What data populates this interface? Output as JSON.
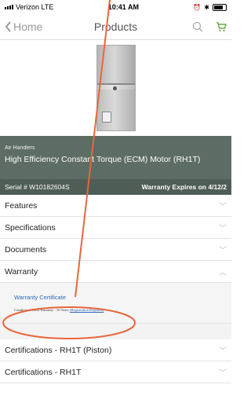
{
  "status_bar": {
    "carrier": "Verizon",
    "network": "LTE",
    "time": "10:41 AM"
  },
  "nav": {
    "back_label": "Home",
    "title": "Products",
    "icons": [
      "back-chevron-icon",
      "search-icon",
      "cart-icon"
    ]
  },
  "product": {
    "category": "Air Handlers",
    "name": "High Efficiency Constant Torque (ECM) Motor (RH1T)",
    "serial": "Serial # W10182604S",
    "warranty_expires": "Warranty Expires on 4/12/2"
  },
  "sections": [
    {
      "label": "Features"
    },
    {
      "label": "Specifications"
    },
    {
      "label": "Documents"
    },
    {
      "label": "Warranty"
    }
  ],
  "warranty": {
    "certificate_link": "Warranty Certificate",
    "terms_prefix": "Conditional Parts Warranty - 10 Years",
    "terms_link": "(Registration Required)"
  },
  "more_sections": [
    {
      "label": "Certifications - RH1T (Piston)"
    },
    {
      "label": "Certifications - RH1T"
    }
  ],
  "colors": {
    "banner": "#5d6d66",
    "link": "#2b67b8",
    "cart": "#6aa84f",
    "annotation": "#e8663c"
  }
}
